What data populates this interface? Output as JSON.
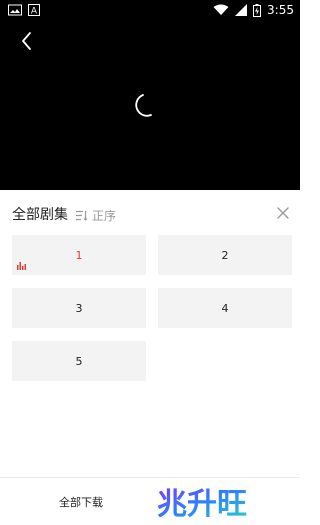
{
  "status": {
    "time": "3:55"
  },
  "panel": {
    "title": "全部剧集",
    "sort_label": "正序"
  },
  "episodes": [
    {
      "label": "1",
      "active": true
    },
    {
      "label": "2",
      "active": false
    },
    {
      "label": "3",
      "active": false
    },
    {
      "label": "4",
      "active": false
    },
    {
      "label": "5",
      "active": false
    }
  ],
  "bottom": {
    "download_label": "全部下载",
    "logo_text": "兆升旺"
  },
  "colors": {
    "active": "#e53935",
    "tile_bg": "#f3f3f3"
  }
}
